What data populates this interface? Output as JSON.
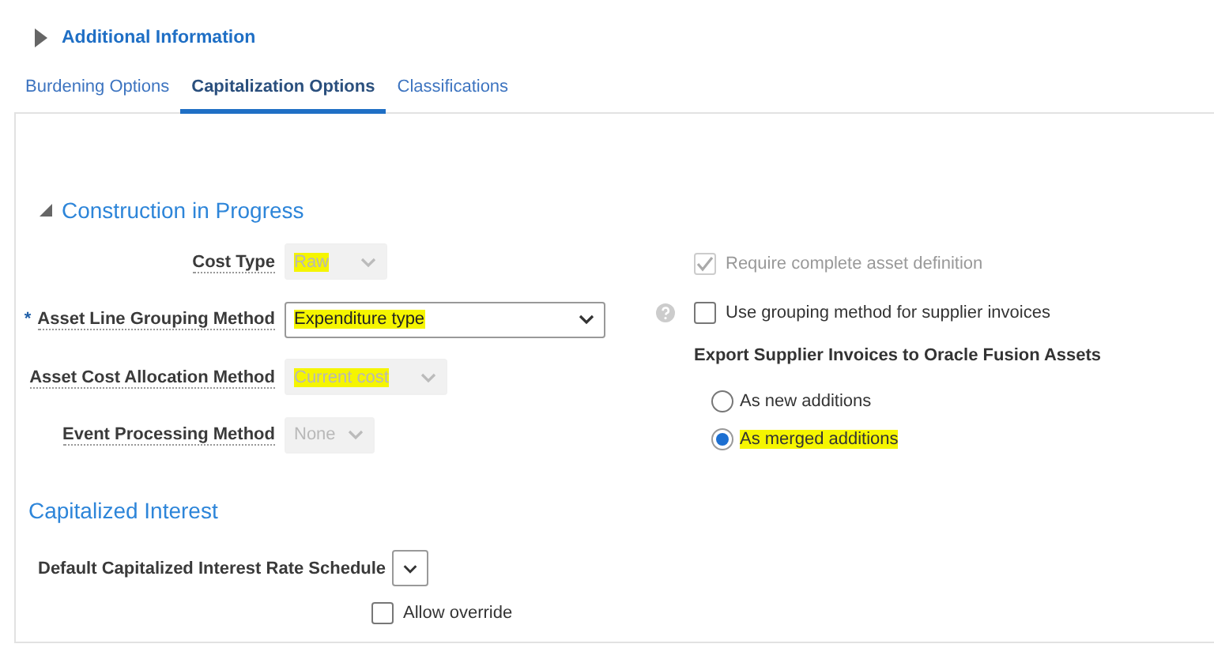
{
  "section": {
    "title": "Additional Information",
    "expanded": false
  },
  "tabs": [
    {
      "label": "Burdening Options",
      "selected": false
    },
    {
      "label": "Capitalization Options",
      "selected": true
    },
    {
      "label": "Classifications",
      "selected": false
    }
  ],
  "cip": {
    "title": "Construction in Progress",
    "expanded": true,
    "fields": [
      {
        "label": "Cost Type",
        "value": "Raw",
        "disabled": true,
        "highlighted": true
      },
      {
        "label": "Asset Line Grouping Method",
        "value": "Expenditure type",
        "marker": "*",
        "disabled": false,
        "highlighted": true
      },
      {
        "label": "Asset Cost Allocation Method",
        "value": "Current cost",
        "disabled": true,
        "highlighted": true
      },
      {
        "label": "Event Processing Method",
        "value": "None",
        "disabled": true,
        "highlighted": false
      }
    ],
    "checkboxes": [
      {
        "label": "Require complete asset definition",
        "checked": true,
        "disabled": true,
        "help": false
      },
      {
        "label": "Use grouping method for supplier invoices",
        "checked": false,
        "disabled": false,
        "help": true
      }
    ],
    "export": {
      "title": "Export Supplier Invoices to Oracle Fusion Assets",
      "options": [
        {
          "label": "As new additions",
          "selected": false,
          "highlighted": false
        },
        {
          "label": "As merged additions",
          "selected": true,
          "highlighted": true
        }
      ]
    }
  },
  "interest": {
    "title": "Capitalized Interest",
    "field": {
      "label": "Default Capitalized Interest Rate Schedule",
      "disabled": false
    },
    "allow_override": {
      "label": "Allow override",
      "checked": false
    }
  }
}
